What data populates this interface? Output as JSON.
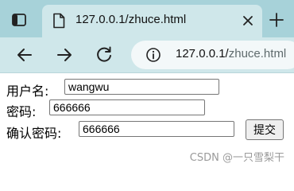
{
  "browser": {
    "sidebar_icon": "sidebar-toggle-icon",
    "tab": {
      "favicon": "document-icon",
      "title": "127.0.0.1/zhuce.html",
      "close_icon": "close-icon"
    },
    "new_tab_icon": "plus-icon",
    "toolbar": {
      "back_icon": "back-arrow-icon",
      "forward_icon": "forward-arrow-icon",
      "reload_icon": "reload-icon",
      "info_icon": "info-icon",
      "url_host": "127.0.0.1/",
      "url_path": "zhuce.html"
    }
  },
  "form": {
    "username_label": "用户名:",
    "username_value": "wangwu",
    "password_label": "密码:",
    "password_value": "666666",
    "confirm_label": "确认密码:",
    "confirm_value": "666666",
    "submit_label": "提交"
  },
  "watermark": "CSDN @一只雪梨干",
  "colors": {
    "tab_strip": "#a7d2d9",
    "toolbar": "#cfe7ea",
    "address_bar": "#f3f8f9"
  }
}
